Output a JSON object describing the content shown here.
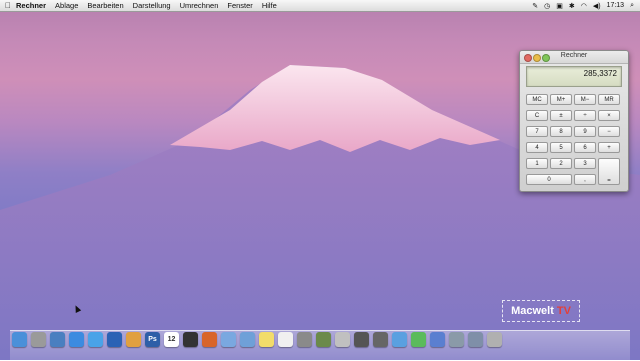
{
  "menubar": {
    "apple_glyph": "",
    "menus": [
      "Rechner",
      "Ablage",
      "Bearbeiten",
      "Darstellung",
      "Umrechnen",
      "Fenster",
      "Hilfe"
    ],
    "clock": "17:13"
  },
  "calculator": {
    "title": "Rechner",
    "display": "285,3372",
    "keys": {
      "mc": "MC",
      "mplus": "M+",
      "mminus": "M−",
      "mr": "MR",
      "c": "C",
      "plusminus": "±",
      "divide": "÷",
      "multiply": "×",
      "k7": "7",
      "k8": "8",
      "k9": "9",
      "minus": "−",
      "k4": "4",
      "k5": "5",
      "k6": "6",
      "plus": "+",
      "k1": "1",
      "k2": "2",
      "k3": "3",
      "k0": "0",
      "comma": ",",
      "equals": "="
    }
  },
  "watermark": {
    "part1": "Macwelt",
    "part2": "TV"
  },
  "dock": {
    "icons": [
      "finder-icon",
      "launchpad-icon",
      "mission-control-icon",
      "safari-icon",
      "itunes-icon",
      "word-icon",
      "photos-icon",
      "photoshop-icon",
      "calendar-icon",
      "activity-monitor-icon",
      "firefox-icon",
      "mail-icon",
      "preview-icon",
      "notes-icon",
      "textedit-icon",
      "system-preferences-icon",
      "script-icon",
      "finder-window-icon",
      "quicktime-icon",
      "calculator-icon",
      "pages-icon",
      "numbers-icon",
      "keynote-icon",
      "itunes-folder-icon",
      "downloads-icon",
      "trash-icon"
    ],
    "colors": [
      "#4a90d9",
      "#9a9a9a",
      "#4a7fc0",
      "#3c8be0",
      "#4aa3e8",
      "#2b62b5",
      "#e0a040",
      "#2e5fa8",
      "#ffffff",
      "#333333",
      "#d8652a",
      "#7aa8e0",
      "#6fa0d8",
      "#f2dc6a",
      "#f0f0f0",
      "#8a8a8a",
      "#6b8a4a",
      "#c0c0c0",
      "#555555",
      "#666666",
      "#5aa0e0",
      "#5bbb5b",
      "#5a7fd0",
      "#8a9aa8",
      "#7f8fa8",
      "#b0b0b0"
    ]
  }
}
